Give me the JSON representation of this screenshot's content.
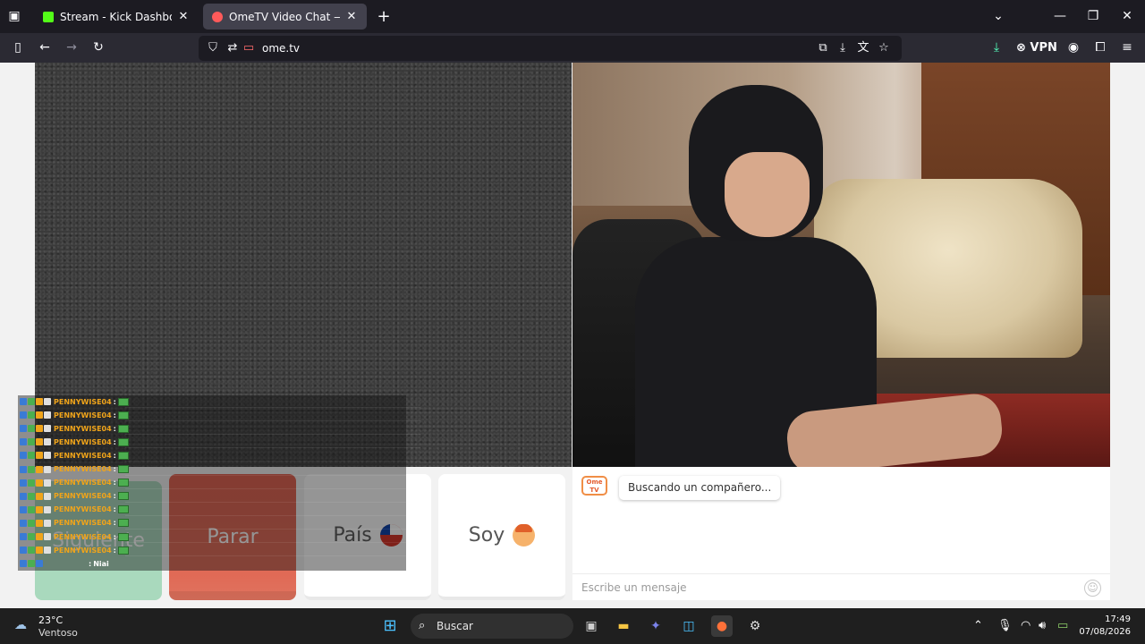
{
  "browser": {
    "tabs": [
      {
        "title": "Stream - Kick Dashboard",
        "active": false,
        "favicon_color": "#53fc18"
      },
      {
        "title": "OmeTV Video Chat — Omegle Alternative",
        "active": true,
        "favicon_color": "#ff5a5a"
      }
    ],
    "url": "ome.tv",
    "vpn_label": "VPN",
    "icons": {
      "list_all_tabs": "tabs-list-icon",
      "new_tab": "plus-icon",
      "back": "back-arrow-icon",
      "forward": "forward-arrow-icon",
      "reload": "reload-icon",
      "sidebar": "sidebar-icon",
      "shield": "shield-icon",
      "permissions": "permissions-icon",
      "page_icon": "camera-icon",
      "screenshot": "screenshot-icon",
      "download_page": "save-page-icon",
      "translate": "translate-icon",
      "bookmark": "star-icon",
      "downloads": "download-icon",
      "account": "account-icon",
      "extensions": "extensions-icon",
      "menu": "hamburger-icon"
    }
  },
  "page": {
    "buttons": {
      "next": "Siguiente",
      "stop": "Parar",
      "country": "País",
      "me": "Soy"
    },
    "chat": {
      "logo_text": "Ome TV",
      "status_message": "Buscando un compañero...",
      "input_placeholder": "Escribe un mensaje"
    },
    "overlay_log": {
      "lines": [
        {
          "user": "PENNYWISE04",
          "sep": ":"
        },
        {
          "user": "PENNYWISE04",
          "sep": ":"
        },
        {
          "user": "PENNYWISE04",
          "sep": ":"
        },
        {
          "user": "PENNYWISE04",
          "sep": ":"
        },
        {
          "user": "PENNYWISE04",
          "sep": ":"
        },
        {
          "user": "PENNYWISE04",
          "sep": ":"
        },
        {
          "user": "PENNYWISE04",
          "sep": ":"
        },
        {
          "user": "PENNYWISE04",
          "sep": ":"
        },
        {
          "user": "PENNYWISE04",
          "sep": ":"
        },
        {
          "user": "PENNYWISE04",
          "sep": ":"
        },
        {
          "user": "PENNYWISE04",
          "sep": ":"
        },
        {
          "user": "PENNYWISE04",
          "sep": ":"
        }
      ],
      "last_line": {
        "sep": ":",
        "message": "Niai"
      }
    }
  },
  "taskbar": {
    "weather": {
      "temp": "23°C",
      "desc": "Ventoso"
    },
    "search_label": "Buscar",
    "time": "17:49",
    "date": "07/08/2026"
  },
  "colors": {
    "next_button": "#a9d9bd",
    "stop_button": "#e25d4b",
    "username": "#f0a41a"
  }
}
